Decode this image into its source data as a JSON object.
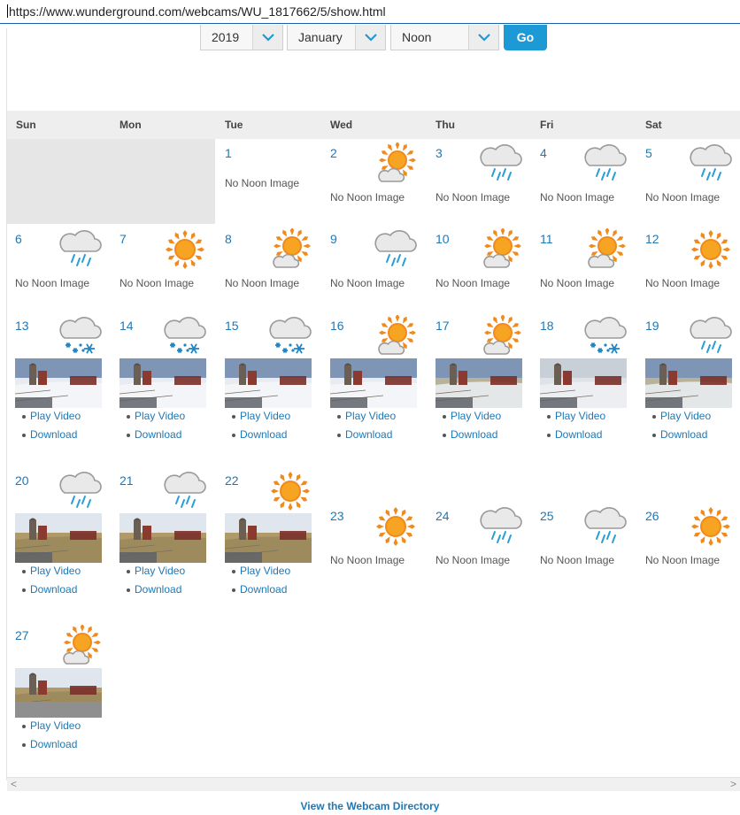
{
  "browser": {
    "url": "https://www.wunderground.com/webcams/WU_1817662/5/show.html"
  },
  "filters": {
    "year": "2019",
    "month": "January",
    "time": "Noon",
    "go_label": "Go"
  },
  "calendar": {
    "daynames": [
      "Sun",
      "Mon",
      "Tue",
      "Wed",
      "Thu",
      "Fri",
      "Sat"
    ],
    "no_image_text": "No Noon Image",
    "play_label": "Play Video",
    "download_label": "Download",
    "days": [
      {
        "day": "1",
        "condition": "none",
        "no_image": true
      },
      {
        "day": "2",
        "condition": "partly-sunny",
        "no_image": true
      },
      {
        "day": "3",
        "condition": "rain",
        "no_image": true
      },
      {
        "day": "4",
        "condition": "rain",
        "no_image": true
      },
      {
        "day": "5",
        "condition": "rain",
        "no_image": true
      },
      {
        "day": "6",
        "condition": "rain",
        "no_image": true
      },
      {
        "day": "7",
        "condition": "sunny",
        "no_image": true
      },
      {
        "day": "8",
        "condition": "partly-sunny",
        "no_image": true
      },
      {
        "day": "9",
        "condition": "rain",
        "no_image": true
      },
      {
        "day": "10",
        "condition": "partly-sunny",
        "no_image": true
      },
      {
        "day": "11",
        "condition": "partly-sunny",
        "no_image": true
      },
      {
        "day": "12",
        "condition": "sunny",
        "no_image": true
      },
      {
        "day": "13",
        "condition": "snow",
        "no_image": false,
        "scene": "snow"
      },
      {
        "day": "14",
        "condition": "snow",
        "no_image": false,
        "scene": "snow"
      },
      {
        "day": "15",
        "condition": "snow",
        "no_image": false,
        "scene": "snow"
      },
      {
        "day": "16",
        "condition": "partly-sunny",
        "no_image": false,
        "scene": "snow"
      },
      {
        "day": "17",
        "condition": "partly-sunny",
        "no_image": false,
        "scene": "melt"
      },
      {
        "day": "18",
        "condition": "snow",
        "no_image": false,
        "scene": "foggy"
      },
      {
        "day": "19",
        "condition": "rain",
        "no_image": false,
        "scene": "melt"
      },
      {
        "day": "20",
        "condition": "rain",
        "no_image": false,
        "scene": "grass"
      },
      {
        "day": "21",
        "condition": "rain",
        "no_image": false,
        "scene": "grass"
      },
      {
        "day": "22",
        "condition": "sunny",
        "no_image": false,
        "scene": "grass"
      },
      {
        "day": "23",
        "condition": "sunny",
        "no_image": true
      },
      {
        "day": "24",
        "condition": "rain",
        "no_image": true
      },
      {
        "day": "25",
        "condition": "rain",
        "no_image": true
      },
      {
        "day": "26",
        "condition": "sunny",
        "no_image": true
      },
      {
        "day": "27",
        "condition": "partly-sunny",
        "no_image": false,
        "scene": "grass-bottom"
      }
    ]
  },
  "footer": {
    "directory_link": "View the Webcam Directory"
  },
  "colors": {
    "link": "#1f78b4",
    "go_button": "#1d9ad6",
    "sun": "#f08a1c",
    "rain": "#2a9fd6"
  }
}
